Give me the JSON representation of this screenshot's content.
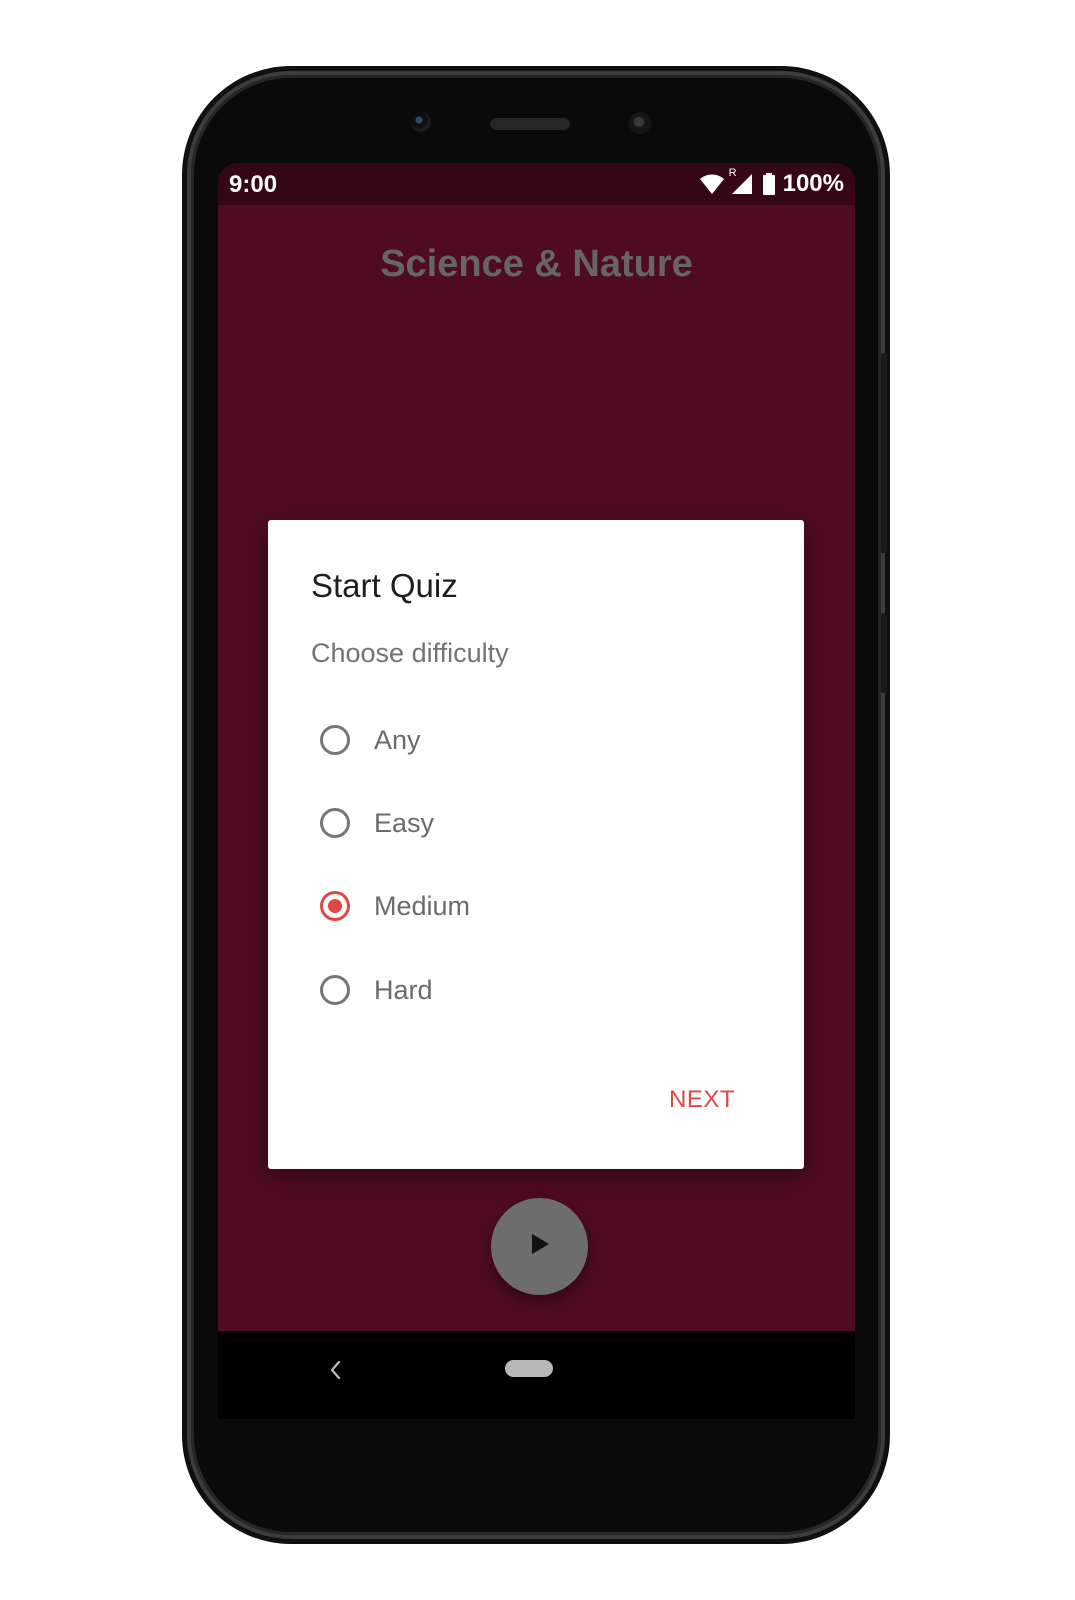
{
  "status_bar": {
    "time": "9:00",
    "battery": "100%",
    "icons": [
      "wifi-icon",
      "signal-icon",
      "battery-icon"
    ],
    "roaming_indicator": "R"
  },
  "app": {
    "title": "Science & Nature"
  },
  "dialog": {
    "title": "Start Quiz",
    "subtitle": "Choose difficulty",
    "options": [
      {
        "label": "Any",
        "checked": false
      },
      {
        "label": "Easy",
        "checked": false
      },
      {
        "label": "Medium",
        "checked": true
      },
      {
        "label": "Hard",
        "checked": false
      }
    ],
    "next_label": "NEXT"
  },
  "fab": {
    "icon": "play-icon"
  },
  "nav": {
    "back_icon": "back-chevron-icon",
    "home_icon": "home-pill-icon"
  },
  "colors": {
    "background": "#560d25",
    "status_bar": "#350615",
    "accent": "#e04848",
    "title_text": "#6e6e6e",
    "fab": "#6d6d6d"
  }
}
